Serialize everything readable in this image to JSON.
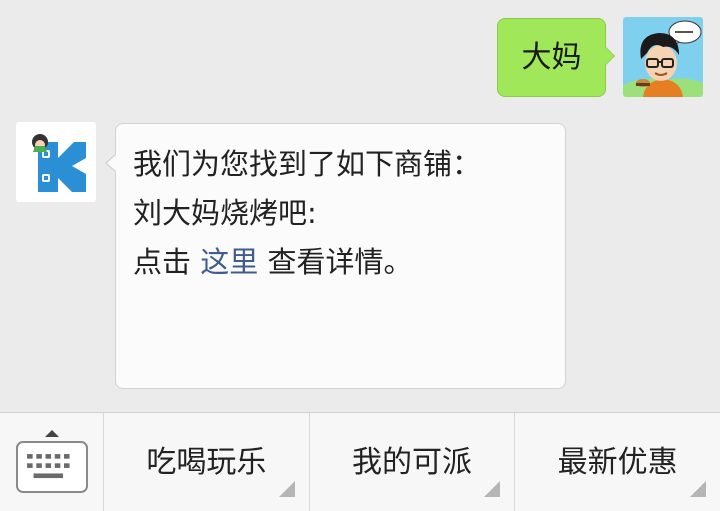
{
  "chat": {
    "outgoing_text": "大妈",
    "incoming": {
      "line1": "我们为您找到了如下商铺：",
      "line2": "刘大妈烧烤吧:",
      "line3_prefix": "点击 ",
      "line3_link": "这里",
      "line3_suffix": " 查看详情。"
    }
  },
  "menu": {
    "keyboard_icon": "keyboard-icon",
    "items": [
      {
        "label": "吃喝玩乐"
      },
      {
        "label": "我的可派"
      },
      {
        "label": "最新优惠"
      }
    ]
  },
  "colors": {
    "background": "#ebebeb",
    "outgoing_bubble": "#a0e75a",
    "incoming_bubble": "#fbfbfb",
    "link": "#3f5c8c"
  }
}
